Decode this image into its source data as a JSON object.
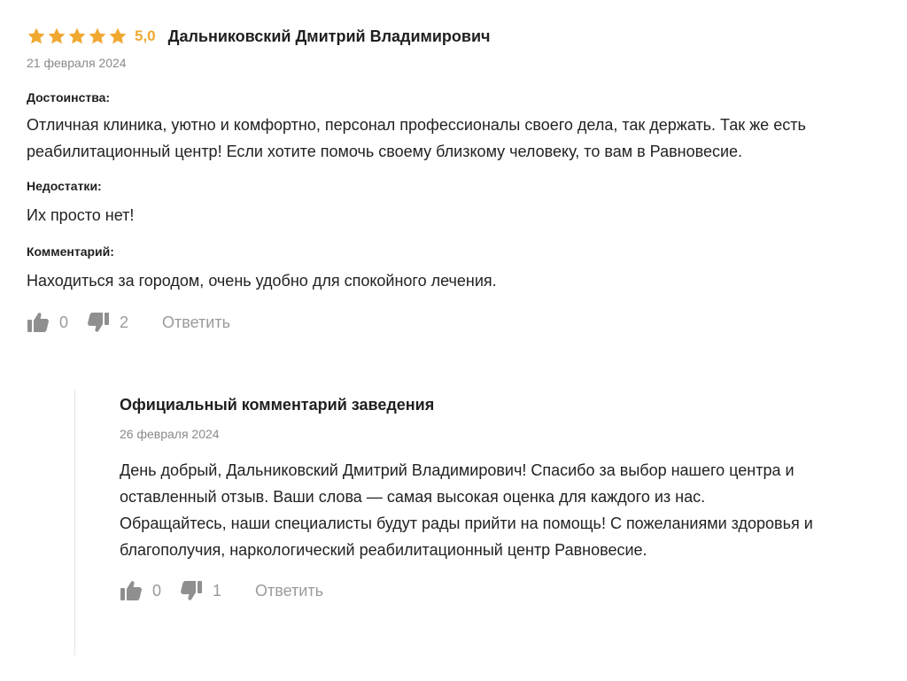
{
  "review": {
    "rating_value": 5,
    "rating_text": "5,0",
    "star_color": "#f0a830",
    "author": "Дальниковский Дмитрий Владимирович",
    "date": "21 февраля 2024",
    "pros_title": "Достоинства:",
    "pros_text": "Отличная клиника, уютно и комфортно, персонал профессионалы своего дела, так держать. Так же есть реабилитационный центр! Если хотите помочь своему близкому человеку, то вам в Равновесие.",
    "cons_title": "Недостатки:",
    "cons_text": "Их просто нет!",
    "comment_title": "Комментарий:",
    "comment_text": "Находиться за городом, очень удобно для спокойного лечения.",
    "likes": "0",
    "dislikes": "2",
    "reply_label": "Ответить"
  },
  "official_reply": {
    "title": "Официальный комментарий заведения",
    "date": "26 февраля 2024",
    "text": "День добрый, Дальниковский Дмитрий Владимирович! Спасибо за выбор нашего центра и оставленный отзыв. Ваши слова — самая высокая оценка для каждого из нас.\nОбращайтесь, наши специалисты будут рады прийти на помощь! С пожеланиями здоровья и благополучия, наркологический реабилитационный центр Равновесие.",
    "likes": "0",
    "dislikes": "1",
    "reply_label": "Ответить"
  },
  "icons": {
    "like": "thumbs-up-icon",
    "dislike": "thumbs-down-icon",
    "star": "star-icon"
  }
}
